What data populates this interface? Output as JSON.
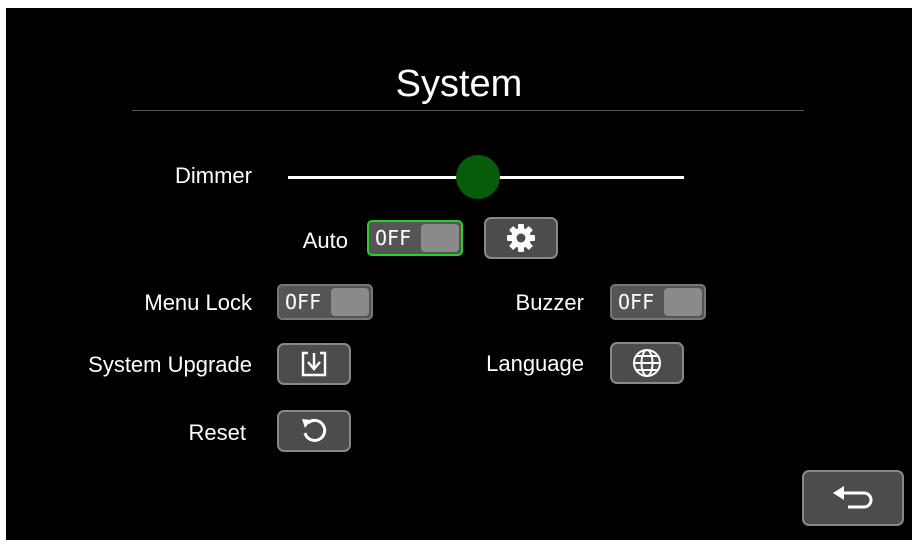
{
  "header": {
    "title": "System"
  },
  "dimmer": {
    "label": "Dimmer",
    "level_fraction": 0.48
  },
  "auto": {
    "label": "Auto",
    "state": "OFF"
  },
  "menu_lock": {
    "label": "Menu Lock",
    "state": "OFF"
  },
  "buzzer": {
    "label": "Buzzer",
    "state": "OFF"
  },
  "system_upgrade": {
    "label": "System Upgrade"
  },
  "language": {
    "label": "Language"
  },
  "reset": {
    "label": "Reset"
  },
  "icons": {
    "auto_settings": "gear-icon",
    "system_upgrade": "download-icon",
    "language": "globe-icon",
    "reset": "refresh-icon",
    "back": "back-arrow-icon"
  },
  "colors": {
    "background": "#000000",
    "button": "#4c4c4c",
    "slider_thumb": "#075c0b",
    "active_toggle_border": "#25d22d"
  }
}
